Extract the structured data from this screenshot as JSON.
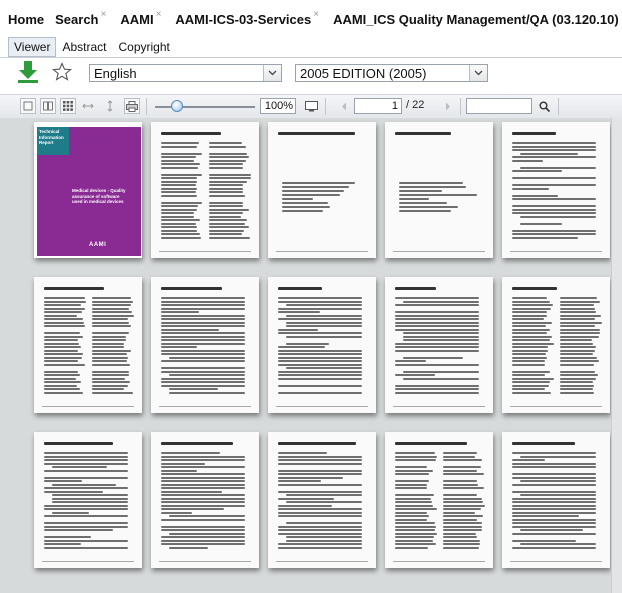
{
  "breadcrumbs": [
    {
      "label": "Home",
      "closable": false
    },
    {
      "label": "Search",
      "closable": true
    },
    {
      "label": "AAMI",
      "closable": true
    },
    {
      "label": "AAMI-ICS-03-Services",
      "closable": true
    },
    {
      "label": "AAMI_ICS Quality Management/QA (03.120.10)",
      "closable": false
    }
  ],
  "close_glyph": "×",
  "tabs": {
    "viewer": "Viewer",
    "abstract": "Abstract",
    "copyright": "Copyright"
  },
  "toolbar": {
    "language": "English",
    "edition": "2005 EDITION (2005)",
    "zoom": "100%",
    "page_current": "1",
    "page_total": "/ 22",
    "search_value": ""
  },
  "cover": {
    "badge": "Technical Information Report",
    "title": "Medical devices - Quality assurance of software used in medical devices",
    "logo": "AAMI"
  },
  "colors": {
    "accent_purple": "#8a2a93",
    "accent_teal": "#1f7d8a",
    "download_green": "#2e9c3a"
  }
}
